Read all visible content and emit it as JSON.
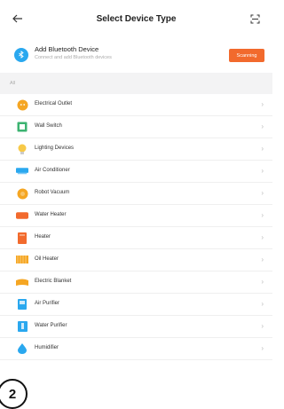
{
  "header": {
    "back_icon": "back-arrow-icon",
    "title": "Select Device Type",
    "scan_icon": "scan-frame-icon"
  },
  "bluetooth": {
    "title": "Add Bluetooth Device",
    "subtitle": "Connect and add Bluetooth devices",
    "button_label": "Scanning",
    "accent": "#f26a2d"
  },
  "section": {
    "label": "All"
  },
  "items": [
    {
      "label": "Electrical Outlet",
      "icon": "outlet-icon",
      "color": "#f5a623"
    },
    {
      "label": "Wall Switch",
      "icon": "switch-icon",
      "color": "#3cb371"
    },
    {
      "label": "Lighting Devices",
      "icon": "bulb-icon",
      "color": "#f7c948"
    },
    {
      "label": "Air Conditioner",
      "icon": "ac-icon",
      "color": "#2aa8ef"
    },
    {
      "label": "Robot Vacuum",
      "icon": "vacuum-icon",
      "color": "#f5a623"
    },
    {
      "label": "Water Heater",
      "icon": "heater-icon",
      "color": "#f26a2d"
    },
    {
      "label": "Heater",
      "icon": "radiator-icon",
      "color": "#f26a2d"
    },
    {
      "label": "Oil Heater",
      "icon": "oil-heater-icon",
      "color": "#f5a623"
    },
    {
      "label": "Electric Blanket",
      "icon": "blanket-icon",
      "color": "#f5a623"
    },
    {
      "label": "Air Purifier",
      "icon": "purifier-icon",
      "color": "#2aa8ef"
    },
    {
      "label": "Water Purifier",
      "icon": "water-purifier-icon",
      "color": "#2aa8ef"
    },
    {
      "label": "Humidifier",
      "icon": "humidifier-icon",
      "color": "#2aa8ef"
    }
  ],
  "badge": {
    "text": "2"
  }
}
